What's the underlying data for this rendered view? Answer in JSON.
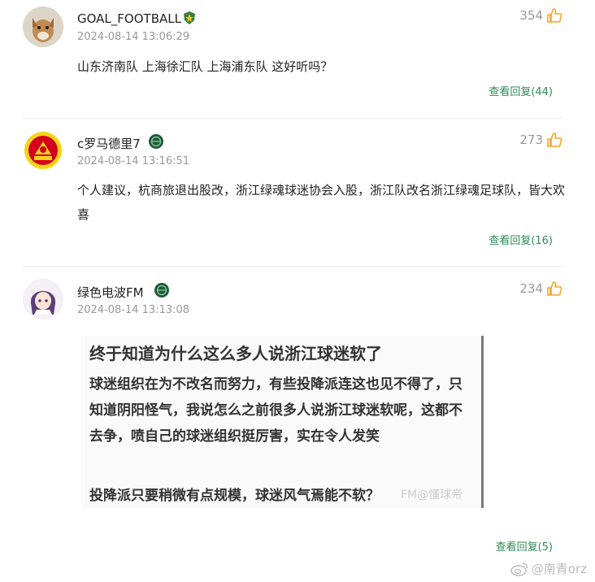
{
  "comments": [
    {
      "username": "GOAL_FOOTBALL",
      "badge": "green-shield-badge",
      "timestamp": "2024-08-14 13:06:29",
      "likes": "354",
      "text": "山东济南队 上海徐汇队 上海浦东队 这好听吗？",
      "replies": "查看回复(44)"
    },
    {
      "username": "c罗马德里7",
      "badge": "green-circle-badge",
      "timestamp": "2024-08-14 13:16:51",
      "likes": "273",
      "text": "个人建议，杭商旅退出股改，浙江绿魂球迷协会入股，浙江队改名浙江绿魂足球队，皆大欢喜",
      "replies": "查看回复(16)"
    },
    {
      "username": "绿色电波FM",
      "badge": "green-circle-badge",
      "timestamp": "2024-08-14 13:13:08",
      "likes": "234",
      "replies": "查看回复(5)",
      "image": {
        "title": "终于知道为什么这么多人说浙江球迷软了",
        "body": "球迷组织在为不改名而努力，有些投降派连这也见不得了，只知道阴阳怪气，我说怎么之前很多人说浙江球迷软呢，这都不去争，喷自己的球迷组织挺厉害，实在令人发笑",
        "last_line": "投降派只要稍微有点规模，球迷风气焉能不软？",
        "watermark": "FM@懂球帝"
      }
    }
  ],
  "watermark": {
    "text": "@南青orz",
    "icon": "weibo-icon"
  },
  "colors": {
    "accent": "#2e8b57",
    "like": "#f5a623",
    "meta": "#999999"
  }
}
